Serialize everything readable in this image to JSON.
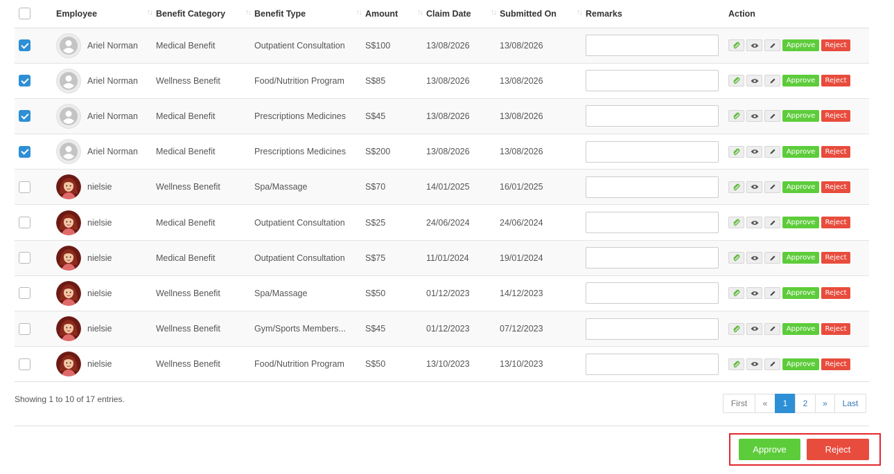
{
  "table": {
    "headers": {
      "employee": "Employee",
      "benefit_category": "Benefit Category",
      "benefit_type": "Benefit Type",
      "amount": "Amount",
      "claim_date": "Claim Date",
      "submitted_on": "Submitted On",
      "remarks": "Remarks",
      "action": "Action"
    },
    "sort_icon": "sort-arrows-icon",
    "row_actions": {
      "approve_label": "Approve",
      "reject_label": "Reject"
    },
    "rows": [
      {
        "checked": true,
        "avatar": "default-user-icon",
        "employee": "Ariel Norman",
        "category": "Medical Benefit",
        "type": "Outpatient Consultation",
        "amount": "S$100",
        "claim_date": "13/08/2026",
        "submitted_on": "13/08/2026",
        "remarks": ""
      },
      {
        "checked": true,
        "avatar": "default-user-icon",
        "employee": "Ariel Norman",
        "category": "Wellness Benefit",
        "type": "Food/Nutrition Program",
        "amount": "S$85",
        "claim_date": "13/08/2026",
        "submitted_on": "13/08/2026",
        "remarks": ""
      },
      {
        "checked": true,
        "avatar": "default-user-icon",
        "employee": "Ariel Norman",
        "category": "Medical Benefit",
        "type": "Prescriptions Medicines",
        "amount": "S$45",
        "claim_date": "13/08/2026",
        "submitted_on": "13/08/2026",
        "remarks": ""
      },
      {
        "checked": true,
        "avatar": "default-user-icon",
        "employee": "Ariel Norman",
        "category": "Medical Benefit",
        "type": "Prescriptions Medicines",
        "amount": "S$200",
        "claim_date": "13/08/2026",
        "submitted_on": "13/08/2026",
        "remarks": ""
      },
      {
        "checked": false,
        "avatar": "woman-avatar",
        "employee": "nielsie",
        "category": "Wellness Benefit",
        "type": "Spa/Massage",
        "amount": "S$70",
        "claim_date": "14/01/2025",
        "submitted_on": "16/01/2025",
        "remarks": ""
      },
      {
        "checked": false,
        "avatar": "woman-avatar",
        "employee": "nielsie",
        "category": "Medical Benefit",
        "type": "Outpatient Consultation",
        "amount": "S$25",
        "claim_date": "24/06/2024",
        "submitted_on": "24/06/2024",
        "remarks": ""
      },
      {
        "checked": false,
        "avatar": "woman-avatar",
        "employee": "nielsie",
        "category": "Medical Benefit",
        "type": "Outpatient Consultation",
        "amount": "S$75",
        "claim_date": "11/01/2024",
        "submitted_on": "19/01/2024",
        "remarks": ""
      },
      {
        "checked": false,
        "avatar": "woman-avatar",
        "employee": "nielsie",
        "category": "Wellness Benefit",
        "type": "Spa/Massage",
        "amount": "S$50",
        "claim_date": "01/12/2023",
        "submitted_on": "14/12/2023",
        "remarks": ""
      },
      {
        "checked": false,
        "avatar": "woman-avatar",
        "employee": "nielsie",
        "category": "Wellness Benefit",
        "type": "Gym/Sports Members...",
        "amount": "S$45",
        "claim_date": "01/12/2023",
        "submitted_on": "07/12/2023",
        "remarks": ""
      },
      {
        "checked": false,
        "avatar": "woman-avatar",
        "employee": "nielsie",
        "category": "Wellness Benefit",
        "type": "Food/Nutrition Program",
        "amount": "S$50",
        "claim_date": "13/10/2023",
        "submitted_on": "13/10/2023",
        "remarks": ""
      }
    ]
  },
  "footer": {
    "info": "Showing 1 to 10 of 17 entries.",
    "pagination": {
      "first": "First",
      "prev": "«",
      "pages": [
        "1",
        "2"
      ],
      "current_page": "1",
      "next": "»",
      "last": "Last"
    }
  },
  "bulk_actions": {
    "approve_label": "Approve",
    "reject_label": "Reject"
  },
  "colors": {
    "approve": "#5dcc3a",
    "reject": "#e84c3d",
    "accent": "#2d8fd5",
    "highlight_box": "#e3262c"
  }
}
